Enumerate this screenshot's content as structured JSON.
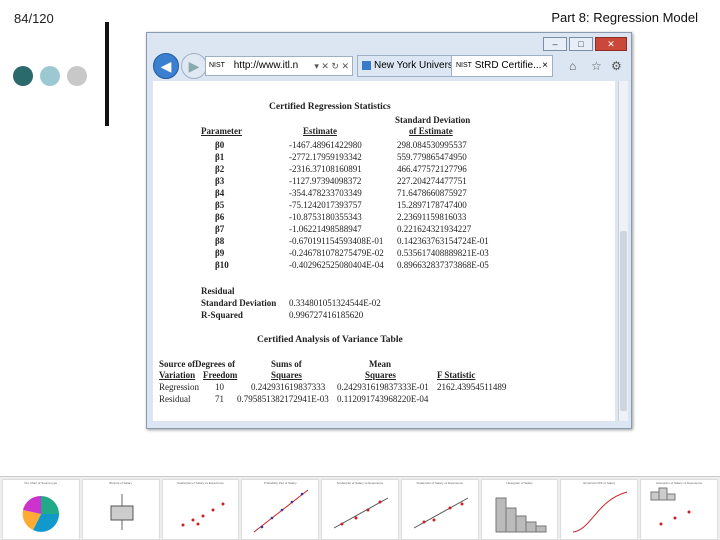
{
  "slide": {
    "number": "84/120",
    "title": "Part 8: Regression Model",
    "dot_colors": [
      "#2a6a6c",
      "#9cc8d2",
      "#c8c8c8"
    ]
  },
  "browser": {
    "url": "http://www.itl.n",
    "tabs": [
      {
        "label": "New York Univers..."
      },
      {
        "label": "StRD Certifie...",
        "close": "×"
      }
    ],
    "favicon_text": "NIST",
    "window_controls": [
      "–",
      "□",
      "✕"
    ],
    "nav": {
      "back": "◀",
      "forward": "▶"
    },
    "addr_controls": "▾ ✕ ↻ ✕",
    "toolbar_icons": [
      "⌂",
      "☆",
      "⚙"
    ]
  },
  "page": {
    "section1_title": "Certified Regression Statistics",
    "col_param": "Parameter",
    "col_estimate": "Estimate",
    "col_sd1": "Standard Deviation",
    "col_sd2": "of Estimate",
    "params": [
      {
        "name": "β0",
        "estimate": "-1467.48961422980",
        "sd": "298.084530995537"
      },
      {
        "name": "β1",
        "estimate": "-2772.17959193342",
        "sd": "559.779865474950"
      },
      {
        "name": "β2",
        "estimate": "-2316.37108160891",
        "sd": "466.477572127796"
      },
      {
        "name": "β3",
        "estimate": "-1127.97394098372",
        "sd": "227.204274477751"
      },
      {
        "name": "β4",
        "estimate": "-354.478233703349",
        "sd": "71.6478660875927"
      },
      {
        "name": "β5",
        "estimate": "-75.1242017393757",
        "sd": "15.2897178747400"
      },
      {
        "name": "β6",
        "estimate": "-10.8753180355343",
        "sd": "2.23691159816033"
      },
      {
        "name": "β7",
        "estimate": "-1.06221498588947",
        "sd": "0.221624321934227"
      },
      {
        "name": "β8",
        "estimate": "-0.670191154593408E-01",
        "sd": "0.142363763154724E-01"
      },
      {
        "name": "β9",
        "estimate": "-0.246781078275479E-02",
        "sd": "0.535617408889821E-03"
      },
      {
        "name": "β10",
        "estimate": "-0.402962525080404E-04",
        "sd": "0.896632837373868E-05"
      }
    ],
    "residual_label": "Residual",
    "residual_sd_label": "Standard Deviation",
    "residual_sd_value": "0.334801051324544E-02",
    "rsq_label": "R-Squared",
    "rsq_value": "0.996727416185620",
    "section2_title": "Certified Analysis of Variance Table",
    "anova_headers": {
      "source1": "Source of",
      "source2": "Variation",
      "df1": "Degrees of",
      "df2": "Freedom",
      "ss1": "Sums of",
      "ss2": "Squares",
      "ms1": "Mean",
      "ms2": "Squares",
      "f": "F Statistic"
    },
    "anova_rows": [
      {
        "source": "Regression",
        "df": "10",
        "ss": "0.242931619837333",
        "ms": "0.242931619837333E-01",
        "f": "2162.43954511489"
      },
      {
        "source": "Residual",
        "df": "71",
        "ss": "0.795851382172941E-03",
        "ms": "0.112091743968220E-04",
        "f": ""
      }
    ]
  },
  "thumbnails": [
    {
      "title": "Pie Chart of Source type"
    },
    {
      "title": "Boxplot of Salary"
    },
    {
      "title": "Scatterplot of Salary vs Experience"
    },
    {
      "title": "Probability Plot of Salary"
    },
    {
      "title": "Scatterplot of Salary vs Experience"
    },
    {
      "title": "Scatterplot of Salary vs Experience"
    },
    {
      "title": "Histogram of Salary"
    },
    {
      "title": "Empirical CDF of Salary"
    },
    {
      "title": "Histogram of Salary vs Experience"
    }
  ]
}
